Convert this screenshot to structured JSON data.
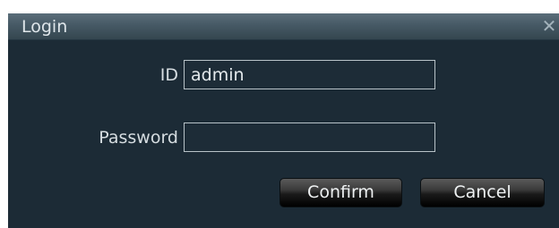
{
  "dialog": {
    "title": "Login",
    "close_icon": "close-icon"
  },
  "form": {
    "id_label": "ID",
    "id_value": "admin",
    "password_label": "Password",
    "password_value": ""
  },
  "buttons": {
    "confirm_label": "Confirm",
    "cancel_label": "Cancel"
  },
  "colors": {
    "titlebar": "#465965",
    "background": "#1c2b36",
    "text": "#d6dde1",
    "input_border": "#b8c3c8",
    "button": "#1a1a1a"
  }
}
